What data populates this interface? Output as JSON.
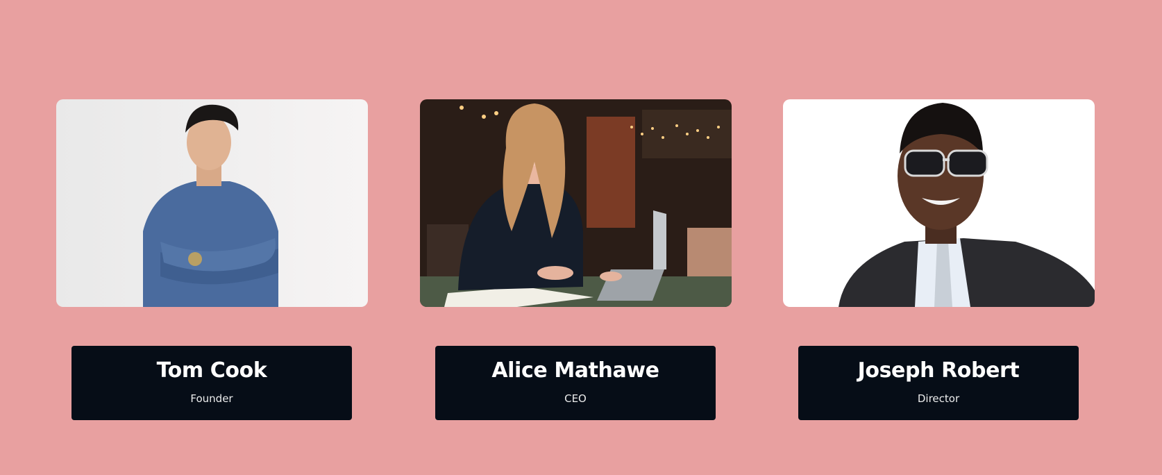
{
  "members": [
    {
      "name": "Tom Cook",
      "role": "Founder"
    },
    {
      "name": "Alice Mathawe",
      "role": "CEO"
    },
    {
      "name": "Joseph Robert",
      "role": "Director"
    }
  ],
  "colors": {
    "background": "#e8a0a0",
    "card_bg": "#060d17",
    "card_text": "#ffffff"
  },
  "icons": {
    "photo_1": "portrait-man-denim-shirt",
    "photo_2": "portrait-woman-laptop-cafe",
    "photo_3": "portrait-man-sunglasses-suit"
  }
}
